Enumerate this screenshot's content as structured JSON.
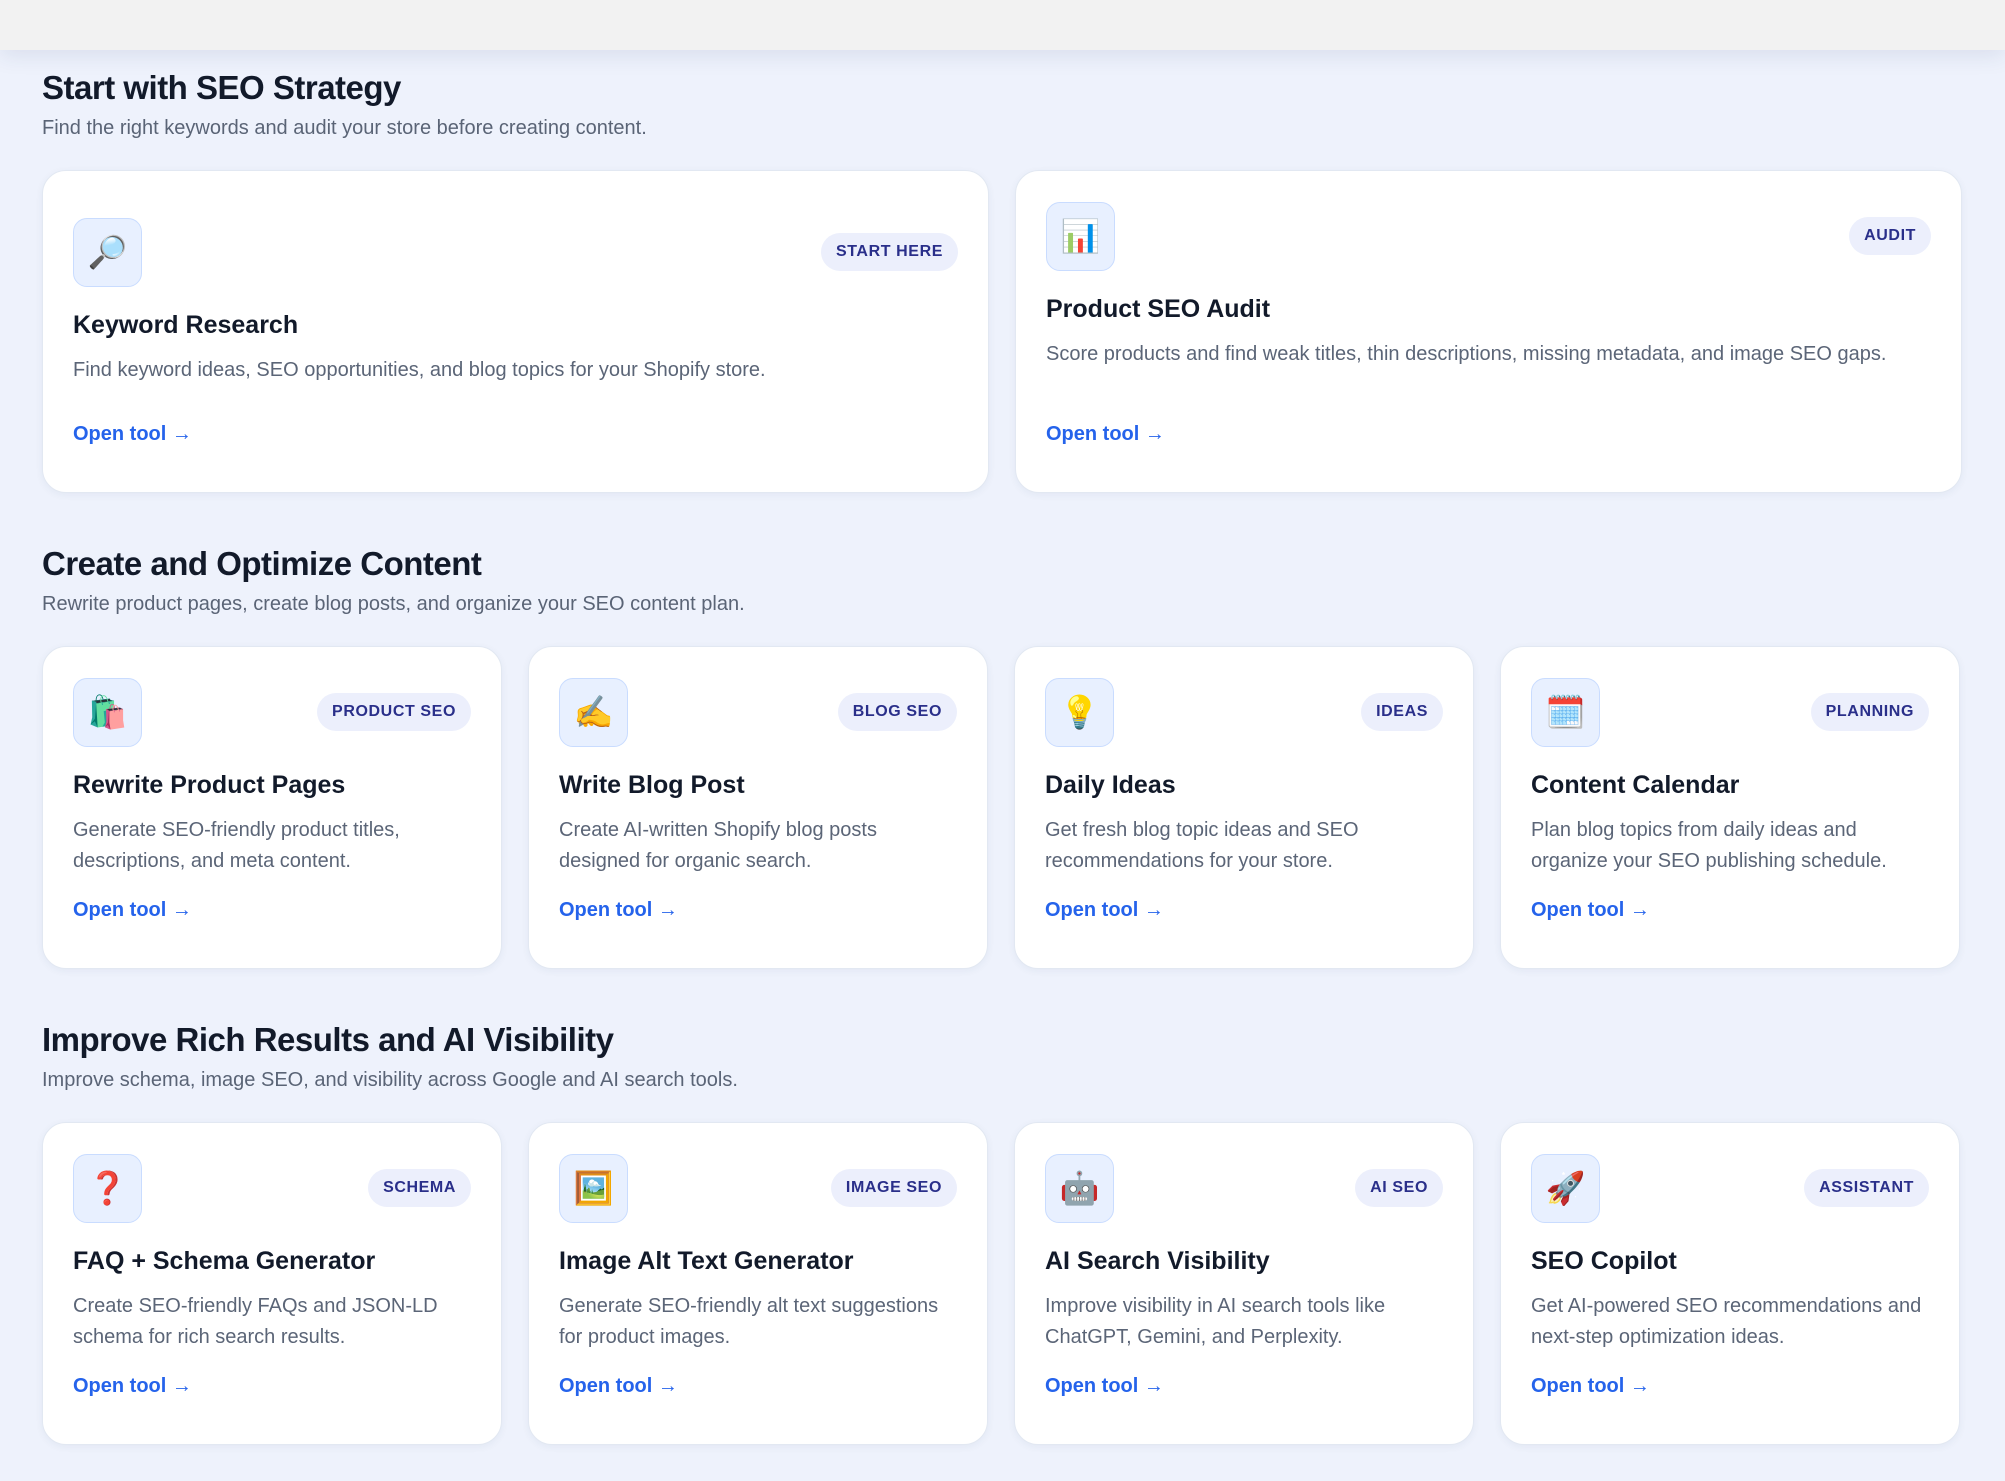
{
  "sections": [
    {
      "title": "Start with SEO Strategy",
      "subtitle": "Find the right keywords and audit your store before creating content.",
      "cards": [
        {
          "icon": "🔎",
          "icon_name": "magnifier-icon",
          "badge": "START HERE",
          "title": "Keyword Research",
          "desc": "Find keyword ideas, SEO opportunities, and blog topics for your Shopify store.",
          "link": "Open tool →"
        },
        {
          "icon": "📊",
          "icon_name": "bar-chart-icon",
          "badge": "AUDIT",
          "title": "Product SEO Audit",
          "desc": "Score products and find weak titles, thin descriptions, missing metadata, and image SEO gaps.",
          "link": "Open tool →"
        }
      ]
    },
    {
      "title": "Create and Optimize Content",
      "subtitle": "Rewrite product pages, create blog posts, and organize your SEO content plan.",
      "cards": [
        {
          "icon": "🛍️",
          "icon_name": "shopping-bags-icon",
          "badge": "PRODUCT SEO",
          "title": "Rewrite Product Pages",
          "desc": "Generate SEO-friendly product titles, descriptions, and meta content.",
          "link": "Open tool →"
        },
        {
          "icon": "✍️",
          "icon_name": "writing-hand-icon",
          "badge": "BLOG SEO",
          "title": "Write Blog Post",
          "desc": "Create AI-written Shopify blog posts designed for organic search.",
          "link": "Open tool →"
        },
        {
          "icon": "💡",
          "icon_name": "lightbulb-icon",
          "badge": "IDEAS",
          "title": "Daily Ideas",
          "desc": "Get fresh blog topic ideas and SEO recommendations for your store.",
          "link": "Open tool →"
        },
        {
          "icon": "🗓️",
          "icon_name": "calendar-icon",
          "badge": "PLANNING",
          "title": "Content Calendar",
          "desc": "Plan blog topics from daily ideas and organize your SEO publishing schedule.",
          "link": "Open tool →"
        }
      ]
    },
    {
      "title": "Improve Rich Results and AI Visibility",
      "subtitle": "Improve schema, image SEO, and visibility across Google and AI search tools.",
      "cards": [
        {
          "icon": "❓",
          "icon_name": "question-mark-icon",
          "badge": "SCHEMA",
          "title": "FAQ + Schema Generator",
          "desc": "Create SEO-friendly FAQs and JSON-LD schema for rich search results.",
          "link": "Open tool →"
        },
        {
          "icon": "🖼️",
          "icon_name": "framed-picture-icon",
          "badge": "IMAGE SEO",
          "title": "Image Alt Text Generator",
          "desc": "Generate SEO-friendly alt text suggestions for product images.",
          "link": "Open tool →"
        },
        {
          "icon": "🤖",
          "icon_name": "robot-icon",
          "badge": "AI SEO",
          "title": "AI Search Visibility",
          "desc": "Improve visibility in AI search tools like ChatGPT, Gemini, and Perplexity.",
          "link": "Open tool →"
        },
        {
          "icon": "🚀",
          "icon_name": "rocket-icon",
          "badge": "ASSISTANT",
          "title": "SEO Copilot",
          "desc": "Get AI-powered SEO recommendations and next-step optimization ideas.",
          "link": "Open tool →"
        }
      ]
    }
  ]
}
